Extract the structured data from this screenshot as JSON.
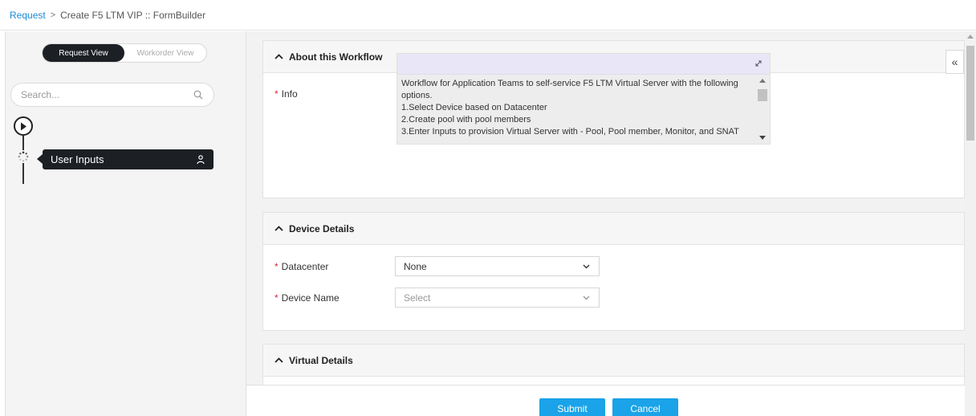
{
  "breadcrumb": {
    "link": "Request",
    "current": "Create F5 LTM VIP :: FormBuilder"
  },
  "sidebar": {
    "view_toggle": {
      "options": [
        "Request View",
        "Workorder View"
      ],
      "selected": "Request View"
    },
    "search": {
      "placeholder": "Search..."
    },
    "steps": [
      {
        "label": "User Inputs",
        "status": "in-progress",
        "icon": "person-icon"
      }
    ]
  },
  "main": {
    "collapse_label": "«",
    "sections": [
      {
        "title": "About this Workflow",
        "fields": [
          {
            "label": "Info",
            "required": true,
            "lines": [
              "Workflow for Application Teams to self-service F5 LTM Virtual Server with the following",
              "options.",
              "1.Select Device based on Datacenter",
              "2.Create pool with pool members",
              "3.Enter Inputs to provision Virtual Server with - Pool, Pool member, Monitor, and SNAT"
            ]
          }
        ]
      },
      {
        "title": "Device Details",
        "fields": [
          {
            "label": "Datacenter",
            "required": true,
            "value": "None"
          },
          {
            "label": "Device Name",
            "required": true,
            "placeholder": "Select"
          }
        ]
      },
      {
        "title": "Virtual Details"
      }
    ]
  },
  "footer": {
    "submit_label": "Submit",
    "cancel_label": "Cancel"
  },
  "colors": {
    "accent": "#1aa3e8",
    "link": "#1b8ad6",
    "dark": "#1c1f24",
    "required": "#e0263a"
  }
}
